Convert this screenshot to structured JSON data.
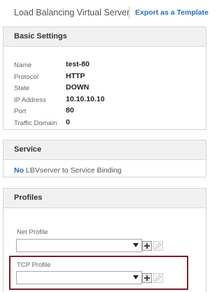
{
  "header": {
    "title": "Load Balancing Virtual Server",
    "export_label": "Export as a Template"
  },
  "basic_settings": {
    "title": "Basic Settings",
    "fields": [
      {
        "label": "Name",
        "value": "test-80"
      },
      {
        "label": "Protocol",
        "value": "HTTP"
      },
      {
        "label": "State",
        "value": "DOWN"
      },
      {
        "label": "IP Address",
        "value": "10.10.10.10"
      },
      {
        "label": "Port",
        "value": "80"
      },
      {
        "label": "Traffic Domain",
        "value": "0"
      }
    ]
  },
  "service": {
    "title": "Service",
    "binding_count": "No",
    "binding_text": "LBVserver to Service Binding"
  },
  "profiles": {
    "title": "Profiles",
    "net_profile_label": "Net Profile",
    "net_profile_value": "",
    "tcp_profile_label": "TCP Profile",
    "tcp_profile_value": ""
  },
  "colors": {
    "link": "#2a6ebb",
    "highlight": "#7a1e2b",
    "header_bg": "#f1f1f1"
  },
  "icons": [
    "plus-icon",
    "pencil-icon",
    "dropdown-caret-icon"
  ]
}
